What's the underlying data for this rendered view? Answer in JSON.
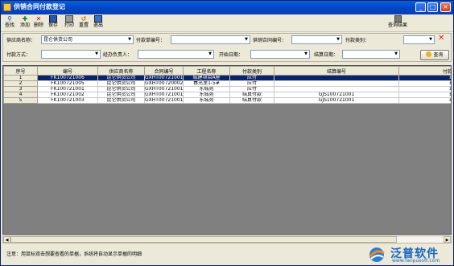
{
  "window": {
    "title": "供销合同付款登记"
  },
  "toolbar": {
    "items": [
      {
        "label": "查找",
        "icon": "binoculars-icon"
      },
      {
        "label": "添加",
        "icon": "add-icon"
      },
      {
        "label": "删除",
        "icon": "delete-icon"
      },
      {
        "label": "保存",
        "icon": "save-icon"
      },
      {
        "label": "打印",
        "icon": "print-icon"
      },
      {
        "label": "重置",
        "icon": "reset-icon"
      },
      {
        "label": "退出",
        "icon": "exit-icon"
      }
    ],
    "query_result_label": "查询结果"
  },
  "filter": {
    "supplier_label": "供应商名称：",
    "supplier_value": "昆仑供货公司",
    "payment_no_label": "付款单编号：",
    "payment_no_value": "",
    "contract_no_label": "供销合同编号：",
    "contract_no_value": "",
    "payment_type_label": "付款类别：",
    "payment_type_value": "",
    "payment_method_label": "付款方式：",
    "payment_method_value": "",
    "handler_label": "经办负责人：",
    "handler_value": "",
    "start_date_label": "开始日期：",
    "start_date_value": "",
    "settle_date_label": "结算日期：",
    "settle_date_value": "",
    "query_button": "查询"
  },
  "table": {
    "columns": [
      "序号",
      "编号",
      "供应商名称",
      "合同编号",
      "工程名称",
      "付款类别",
      "结算编号",
      "付款"
    ],
    "rows": [
      [
        "1",
        "FK100721006",
        "昆仑供货公司",
        "GXHT00721001",
        "城建项目A座",
        "应付",
        "",
        "现"
      ],
      [
        "2",
        "FK100721005",
        "昆仑供货公司",
        "GXHT00720002",
        "春光里1-5#",
        "应付",
        "",
        "现"
      ],
      [
        "3",
        "FK100721001",
        "昆仑供货公司",
        "GXHT00721001",
        "东城苑",
        "应付",
        "",
        "现"
      ],
      [
        "4",
        "FK100721002",
        "昆仑供货公司",
        "GXHT00721001",
        "东城苑",
        "结算付款",
        "GJS100721001",
        "现"
      ],
      [
        "5",
        "FK100721003",
        "昆仑供货公司",
        "GXHT00721001",
        "东城苑",
        "结算付款",
        "GJS100721001",
        "现"
      ]
    ],
    "selected_row": 0
  },
  "status": {
    "note": "注意：用鼠标双击想要查看的单据，系统将自动显示单据的明细"
  },
  "logo": {
    "brand": "泛普软件",
    "url": "www.fanpusoft.com"
  },
  "colors": {
    "title_bar": "#0046c7",
    "selected_row": "#0a246a",
    "brand": "#1565c0"
  }
}
